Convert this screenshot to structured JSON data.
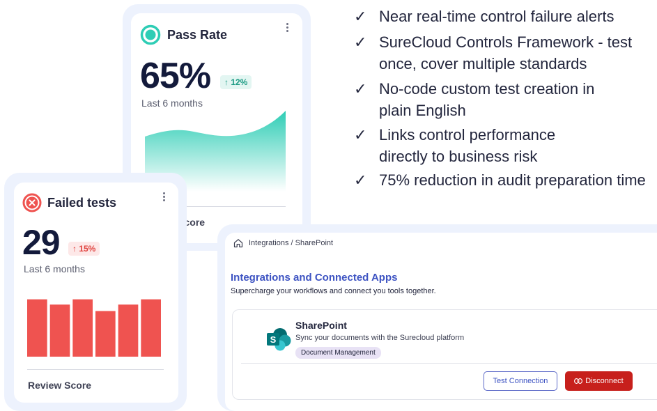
{
  "features": [
    {
      "check": "✓",
      "text": "Near real-time control failure alerts"
    },
    {
      "check": "✓",
      "text": "SureCloud Controls Framework - test\nonce, cover multiple standards"
    },
    {
      "check": "✓",
      "text": "No-code custom test creation in\nplain English"
    },
    {
      "check": "✓",
      "text": "Links control performance\ndirectly to business risk"
    },
    {
      "check": "✓",
      "text": "75% reduction in audit preparation time"
    }
  ],
  "pass_card": {
    "title": "Pass Rate",
    "value": "65%",
    "delta": "↑ 12%",
    "period": "Last 6 months",
    "footer": "Review Score",
    "colors": {
      "accent": "#2ecdb5",
      "delta_bg": "#e3f6f2",
      "delta_fg": "#1d9b84"
    }
  },
  "fail_card": {
    "title": "Failed tests",
    "value": "29",
    "delta": "↑ 15%",
    "period": "Last 6 months",
    "footer": "Review Score",
    "bar_levels": [
      0.98,
      0.89,
      0.98,
      0.78,
      0.89,
      0.98
    ],
    "colors": {
      "accent": "#ef5350",
      "delta_bg": "#fde8e8",
      "delta_fg": "#e0423e"
    }
  },
  "integrations": {
    "breadcrumb": "Integrations / SharePoint",
    "title": "Integrations and Connected Apps",
    "subtitle": "Supercharge your workflows and connect you tools together.",
    "app": {
      "name": "SharePoint",
      "description": "Sync your documents with the Surecloud platform",
      "tag": "Document Management",
      "logo_letter": "S"
    },
    "test_button": "Test Connection",
    "disconnect_button": "Disconnect"
  }
}
